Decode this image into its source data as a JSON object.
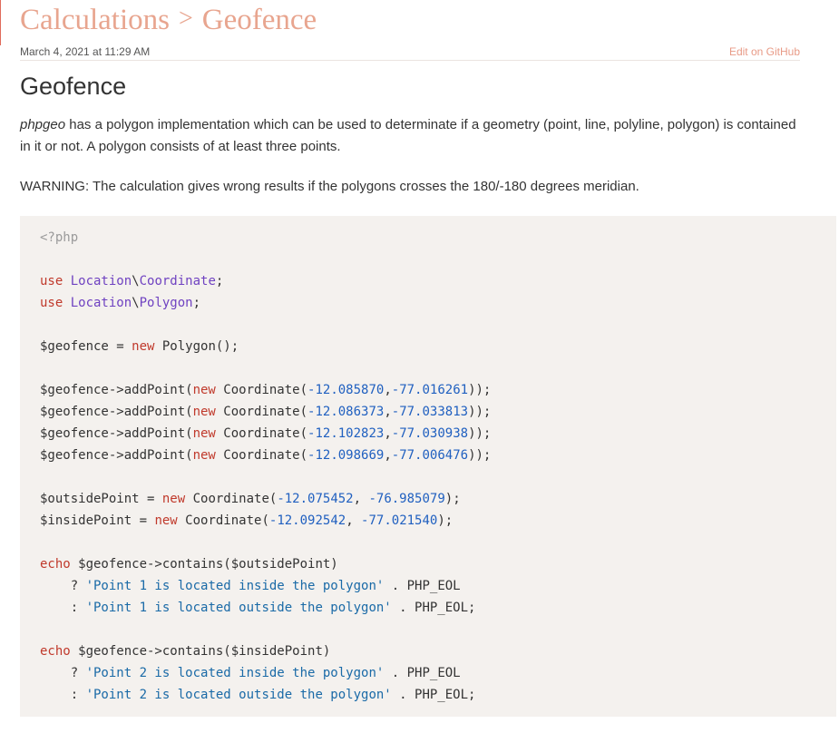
{
  "breadcrumb": {
    "parent": "Calculations",
    "separator": ">",
    "current": "Geofence"
  },
  "meta": {
    "date": "March 4, 2021 at 11:29 AM",
    "edit_link": "Edit on GitHub"
  },
  "title": "Geofence",
  "intro": {
    "lib": "phpgeo",
    "text": " has a polygon implementation which can be used to determinate if a geometry (point, line, polyline, polygon) is contained in it or not. A polygon consists of at least three points."
  },
  "warning": "WARNING: The calculation gives wrong results if the polygons crosses the 180/-180 degrees meridian.",
  "code_lines": [
    [
      {
        "t": "<?php",
        "c": "cm"
      }
    ],
    [],
    [
      {
        "t": "use ",
        "c": "kw"
      },
      {
        "t": "Location",
        "c": "ns"
      },
      {
        "t": "\\",
        "c": ""
      },
      {
        "t": "Coordinate",
        "c": "ns"
      },
      {
        "t": ";",
        "c": ""
      }
    ],
    [
      {
        "t": "use ",
        "c": "kw"
      },
      {
        "t": "Location",
        "c": "ns"
      },
      {
        "t": "\\",
        "c": ""
      },
      {
        "t": "Polygon",
        "c": "ns"
      },
      {
        "t": ";",
        "c": ""
      }
    ],
    [],
    [
      {
        "t": "$geofence = ",
        "c": ""
      },
      {
        "t": "new",
        "c": "kw"
      },
      {
        "t": " Polygon();",
        "c": ""
      }
    ],
    [],
    [
      {
        "t": "$geofence->addPoint(",
        "c": ""
      },
      {
        "t": "new",
        "c": "kw"
      },
      {
        "t": " Coordinate(",
        "c": ""
      },
      {
        "t": "-12.085870",
        "c": "num"
      },
      {
        "t": ",",
        "c": ""
      },
      {
        "t": "-77.016261",
        "c": "num"
      },
      {
        "t": "));",
        "c": ""
      }
    ],
    [
      {
        "t": "$geofence->addPoint(",
        "c": ""
      },
      {
        "t": "new",
        "c": "kw"
      },
      {
        "t": " Coordinate(",
        "c": ""
      },
      {
        "t": "-12.086373",
        "c": "num"
      },
      {
        "t": ",",
        "c": ""
      },
      {
        "t": "-77.033813",
        "c": "num"
      },
      {
        "t": "));",
        "c": ""
      }
    ],
    [
      {
        "t": "$geofence->addPoint(",
        "c": ""
      },
      {
        "t": "new",
        "c": "kw"
      },
      {
        "t": " Coordinate(",
        "c": ""
      },
      {
        "t": "-12.102823",
        "c": "num"
      },
      {
        "t": ",",
        "c": ""
      },
      {
        "t": "-77.030938",
        "c": "num"
      },
      {
        "t": "));",
        "c": ""
      }
    ],
    [
      {
        "t": "$geofence->addPoint(",
        "c": ""
      },
      {
        "t": "new",
        "c": "kw"
      },
      {
        "t": " Coordinate(",
        "c": ""
      },
      {
        "t": "-12.098669",
        "c": "num"
      },
      {
        "t": ",",
        "c": ""
      },
      {
        "t": "-77.006476",
        "c": "num"
      },
      {
        "t": "));",
        "c": ""
      }
    ],
    [],
    [
      {
        "t": "$outsidePoint = ",
        "c": ""
      },
      {
        "t": "new",
        "c": "kw"
      },
      {
        "t": " Coordinate(",
        "c": ""
      },
      {
        "t": "-12.075452",
        "c": "num"
      },
      {
        "t": ", ",
        "c": ""
      },
      {
        "t": "-76.985079",
        "c": "num"
      },
      {
        "t": ");",
        "c": ""
      }
    ],
    [
      {
        "t": "$insidePoint = ",
        "c": ""
      },
      {
        "t": "new",
        "c": "kw"
      },
      {
        "t": " Coordinate(",
        "c": ""
      },
      {
        "t": "-12.092542",
        "c": "num"
      },
      {
        "t": ", ",
        "c": ""
      },
      {
        "t": "-77.021540",
        "c": "num"
      },
      {
        "t": ");",
        "c": ""
      }
    ],
    [],
    [
      {
        "t": "echo",
        "c": "kw"
      },
      {
        "t": " $geofence->contains($outsidePoint)",
        "c": ""
      }
    ],
    [
      {
        "t": "    ? ",
        "c": ""
      },
      {
        "t": "'Point 1 is located inside the polygon'",
        "c": "str"
      },
      {
        "t": " . PHP_EOL",
        "c": ""
      }
    ],
    [
      {
        "t": "    : ",
        "c": ""
      },
      {
        "t": "'Point 1 is located outside the polygon'",
        "c": "str"
      },
      {
        "t": " . PHP_EOL;",
        "c": ""
      }
    ],
    [],
    [
      {
        "t": "echo",
        "c": "kw"
      },
      {
        "t": " $geofence->contains($insidePoint)",
        "c": ""
      }
    ],
    [
      {
        "t": "    ? ",
        "c": ""
      },
      {
        "t": "'Point 2 is located inside the polygon'",
        "c": "str"
      },
      {
        "t": " . PHP_EOL",
        "c": ""
      }
    ],
    [
      {
        "t": "    : ",
        "c": ""
      },
      {
        "t": "'Point 2 is located outside the polygon'",
        "c": "str"
      },
      {
        "t": " . PHP_EOL;",
        "c": ""
      }
    ]
  ]
}
